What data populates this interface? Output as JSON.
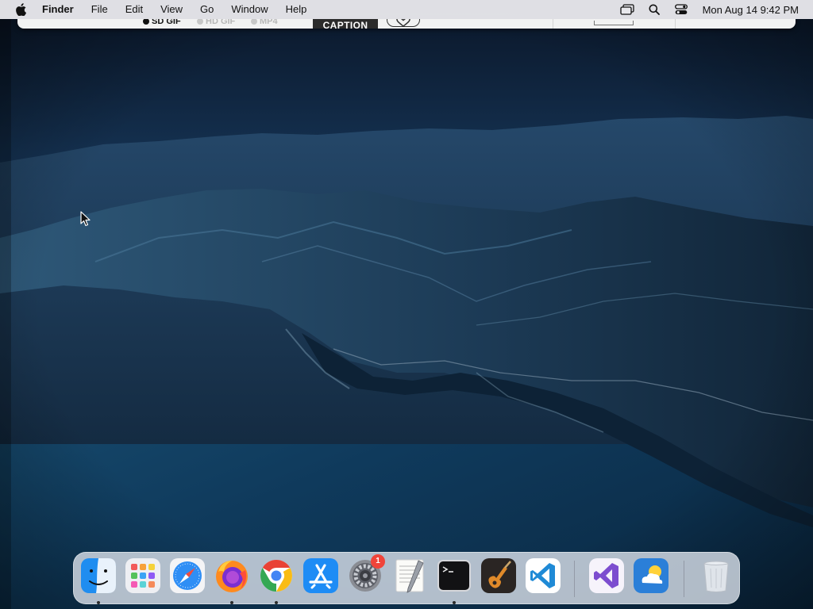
{
  "menubar": {
    "app_name": "Finder",
    "menus": [
      "File",
      "Edit",
      "View",
      "Go",
      "Window",
      "Help"
    ],
    "clock": "Mon Aug 14  9:42 PM",
    "status_icons": [
      "screen-mirroring-icon",
      "spotlight-search-icon",
      "control-center-icon"
    ]
  },
  "background_window": {
    "format_options": [
      {
        "label": "SD GIF",
        "selected": true
      },
      {
        "label": "HD GIF",
        "selected": false
      },
      {
        "label": "MP4",
        "selected": false
      }
    ],
    "caption_label": "CAPTION",
    "favorite_icon": "heart-icon"
  },
  "dock": {
    "apps": [
      {
        "name": "Finder",
        "icon": "finder-icon",
        "running": true
      },
      {
        "name": "Launchpad",
        "icon": "launchpad-icon",
        "running": false
      },
      {
        "name": "Safari",
        "icon": "safari-icon",
        "running": false
      },
      {
        "name": "Firefox",
        "icon": "firefox-icon",
        "running": true
      },
      {
        "name": "Google Chrome",
        "icon": "chrome-icon",
        "running": true
      },
      {
        "name": "App Store",
        "icon": "app-store-icon",
        "running": false
      },
      {
        "name": "System Preferences",
        "icon": "system-preferences-icon",
        "running": false,
        "badge": "1"
      },
      {
        "name": "TextEdit",
        "icon": "textedit-icon",
        "running": false
      },
      {
        "name": "Terminal",
        "icon": "terminal-icon",
        "running": true
      },
      {
        "name": "GarageBand",
        "icon": "garageband-icon",
        "running": false
      },
      {
        "name": "Visual Studio Code",
        "icon": "vscode-icon",
        "running": false
      },
      {
        "name": "Visual Studio",
        "icon": "visual-studio-icon",
        "running": false
      },
      {
        "name": "Weather",
        "icon": "weather-icon",
        "running": false
      },
      {
        "name": "Trash",
        "icon": "trash-icon",
        "running": false
      }
    ]
  },
  "colors": {
    "menubar_bg": "#e8e8ec",
    "dock_bg": "#d7dee8",
    "badge": "#f0443a",
    "wallpaper_sky": "#14304f",
    "wallpaper_sea": "#0f3a5c"
  }
}
